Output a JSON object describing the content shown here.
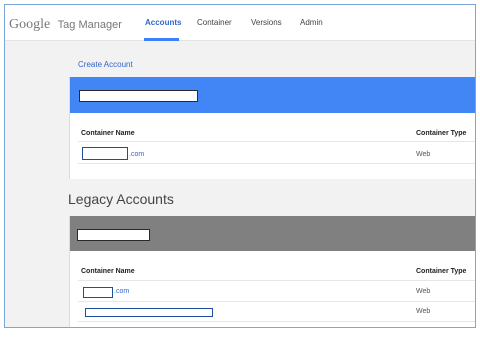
{
  "brand": {
    "google": "Google",
    "product": "Tag Manager"
  },
  "nav": {
    "accounts": "Accounts",
    "container": "Container",
    "versions": "Versions",
    "admin": "Admin"
  },
  "actions": {
    "create_account": "Create Account"
  },
  "columns": {
    "name": "Container Name",
    "type": "Container Type"
  },
  "accounts": {
    "rows": [
      {
        "name_suffix": ".com",
        "type": "Web"
      }
    ]
  },
  "legacy": {
    "title": "Legacy Accounts",
    "rows": [
      {
        "name_suffix": ".com",
        "type": "Web"
      },
      {
        "name_suffix": "",
        "type": "Web"
      }
    ]
  },
  "colors": {
    "accent": "#3d7ff5",
    "link": "#3366cc",
    "account_header": "#4285f4",
    "legacy_header": "#808080"
  }
}
